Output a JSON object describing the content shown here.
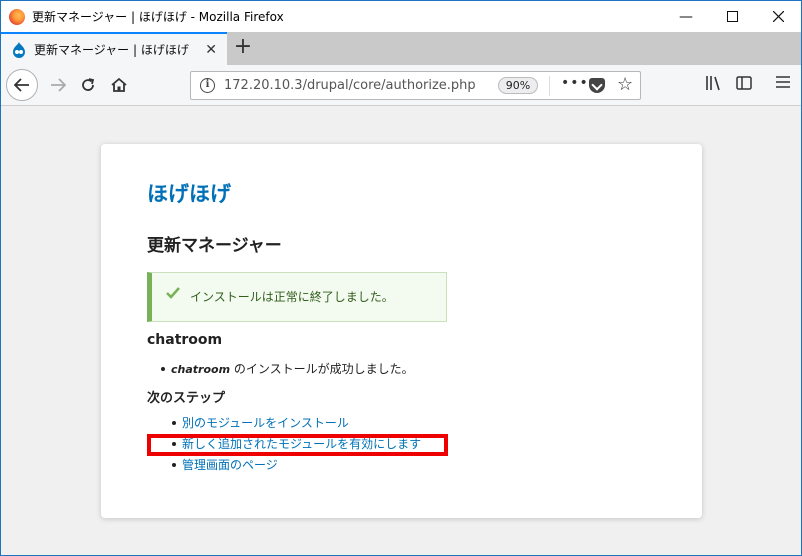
{
  "window": {
    "title": "更新マネージャー | ほげほげ - Mozilla Firefox",
    "minimize": "—",
    "maximize": "☐",
    "close": "✕"
  },
  "tab": {
    "title": "更新マネージャー | ほげほげ",
    "close": "✕",
    "new_tab": "+"
  },
  "navbar": {
    "url": "172.20.10.3/drupal/core/authorize.php",
    "zoom": "90%",
    "more": "•••"
  },
  "page": {
    "site_name": "ほげほげ",
    "title": "更新マネージャー",
    "status_message": "インストールは正常に終了しました。",
    "project_heading": "chatroom",
    "result_project": "chatroom",
    "result_text": " のインストールが成功しました。",
    "next_steps_heading": "次のステップ",
    "next_steps": [
      "別のモジュールをインストール",
      "新しく追加されたモジュールを有効にします",
      "管理画面のページ"
    ]
  },
  "colors": {
    "link": "#0071b8",
    "success_border": "#77b259",
    "highlight": "#ee0000"
  }
}
